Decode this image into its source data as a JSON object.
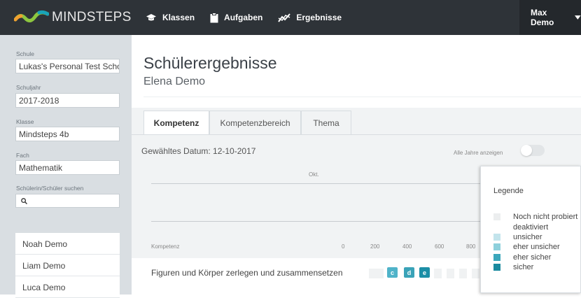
{
  "app": {
    "logo_text": "MINDSTEPS",
    "nav": [
      {
        "label": "Klassen",
        "icon": "graduation-cap-icon"
      },
      {
        "label": "Aufgaben",
        "icon": "clipboard-icon"
      },
      {
        "label": "Ergebnisse",
        "icon": "trend-chart-icon"
      }
    ],
    "user": "Max Demo"
  },
  "sidebar": {
    "school_label": "Schule",
    "school_value": "Lukas's Personal Test Scho",
    "year_label": "Schuljahr",
    "year_value": "2017-2018",
    "class_label": "Klasse",
    "class_value": "Mindsteps 4b",
    "subject_label": "Fach",
    "subject_value": "Mathematik",
    "search_label": "Schülerin/Schüler suchen",
    "search_value": "",
    "students": [
      "Noah Demo",
      "Liam Demo",
      "Luca Demo"
    ]
  },
  "main": {
    "title": "Schülerergebnisse",
    "student_name": "Elena Demo",
    "tabs": [
      "Kompetenz",
      "Kompetenzbereich",
      "Thema"
    ],
    "selected_date": "Gewähltes Datum: 12-10-2017",
    "all_years_label": "Alle Jahre anzeigen",
    "all_years_on": false,
    "timeline_month": "Okt.",
    "kompetenz_header": "Kompetenz",
    "scale_ticks": [
      "0",
      "200",
      "400",
      "600",
      "800"
    ],
    "competency": {
      "label": "Figuren und Körper zerlegen und zusammensetzen",
      "levels": [
        {
          "code": "c",
          "color": "#4fb3c9"
        },
        {
          "code": "d",
          "color": "#3aa3b8"
        },
        {
          "code": "e",
          "color": "#1c8ea6"
        }
      ]
    }
  },
  "legend": {
    "title": "Legende",
    "items": [
      {
        "label": "Noch nicht probiert",
        "color": "#eceeef"
      },
      {
        "label": "deaktiviert",
        "color": "#ffffff"
      },
      {
        "label": "unsicher",
        "color": "#c3e4ec"
      },
      {
        "label": "eher unsicher",
        "color": "#8ed0dc"
      },
      {
        "label": "eher sicher",
        "color": "#3ba7bb"
      },
      {
        "label": "sicher",
        "color": "#1a8a9f"
      }
    ]
  }
}
